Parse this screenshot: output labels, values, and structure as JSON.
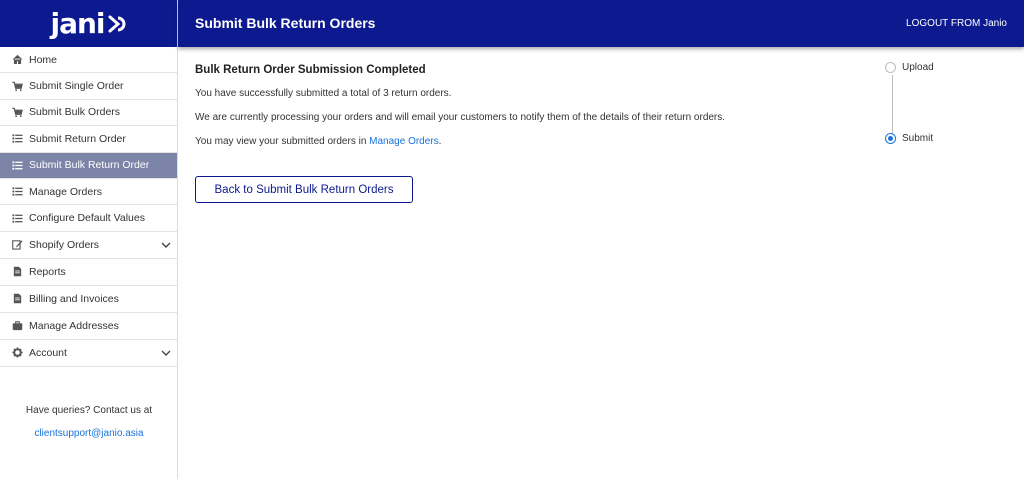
{
  "brand": {
    "logo_text": "jani"
  },
  "header": {
    "title": "Submit Bulk Return Orders",
    "logout": "LOGOUT FROM Janio"
  },
  "sidebar": {
    "items": [
      {
        "label": "Home",
        "icon": "home-icon"
      },
      {
        "label": "Submit Single Order",
        "icon": "cart-icon"
      },
      {
        "label": "Submit Bulk Orders",
        "icon": "cart-icon"
      },
      {
        "label": "Submit Return Order",
        "icon": "list-icon"
      },
      {
        "label": "Submit Bulk Return Order",
        "icon": "list-icon",
        "active": true
      },
      {
        "label": "Manage Orders",
        "icon": "list-icon"
      },
      {
        "label": "Configure Default Values",
        "icon": "list-icon"
      },
      {
        "label": "Shopify Orders",
        "icon": "edit-icon",
        "expandable": true
      },
      {
        "label": "Reports",
        "icon": "file-icon"
      },
      {
        "label": "Billing and Invoices",
        "icon": "file-icon"
      },
      {
        "label": "Manage Addresses",
        "icon": "briefcase-icon"
      },
      {
        "label": "Account",
        "icon": "gear-icon",
        "expandable": true
      }
    ],
    "contact_text": "Have queries? Contact us at",
    "contact_email": "clientsupport@janio.asia"
  },
  "main": {
    "heading": "Bulk Return Order Submission Completed",
    "line1": "You have successfully submitted a total of 3 return orders.",
    "line2": "We are currently processing your orders and will email your customers to notify them of the details of their return orders.",
    "line3_prefix": "You may view your submitted orders in ",
    "line3_link": "Manage Orders",
    "line3_suffix": ".",
    "back_button": "Back to Submit Bulk Return Orders"
  },
  "stepper": {
    "steps": [
      {
        "label": "Upload",
        "selected": false
      },
      {
        "label": "Submit",
        "selected": true
      }
    ]
  },
  "colors": {
    "brand_navy": "#0d1a8f",
    "active_item": "#7c84a8",
    "link": "#1a73d9"
  }
}
